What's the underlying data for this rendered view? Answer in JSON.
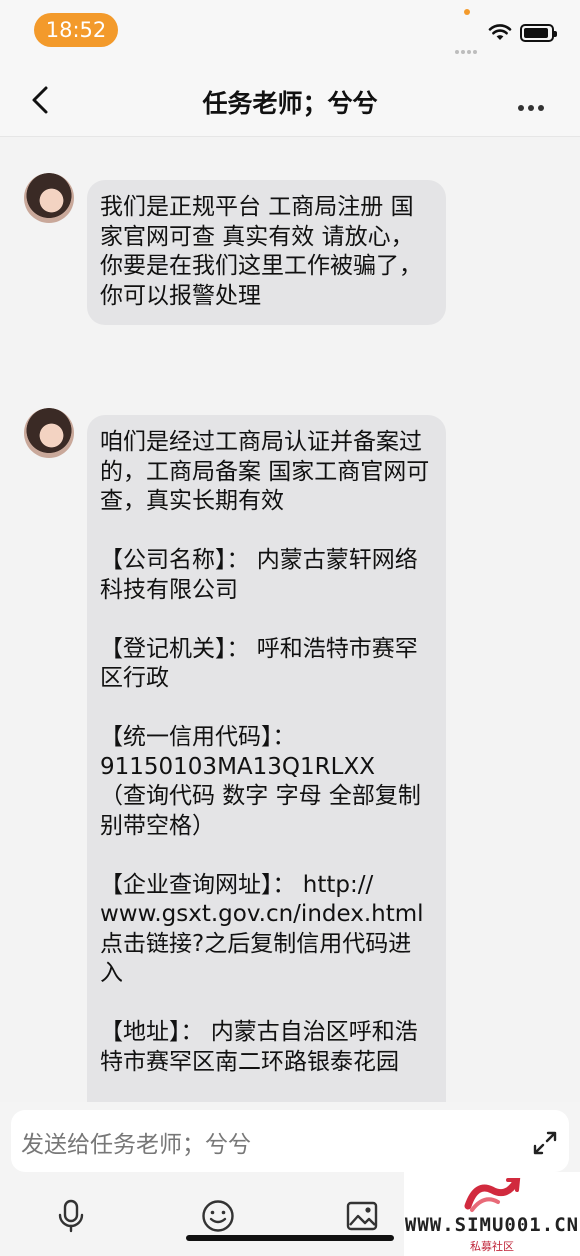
{
  "status_bar": {
    "time": "18:52"
  },
  "header": {
    "title": "任务老师；兮兮"
  },
  "messages": [
    {
      "text": "我们是正规平台 工商局注册 国家官网可查 真实有效 请放心， 你要是在我们这里工作被骗了， 你可以报警处理"
    },
    {
      "text": "咱们是经过工商局认证并备案过的，工商局备案 国家工商官网可查，真实长期有效\n\n【公司名称】： 内蒙古蒙轩网络科技有限公司\n\n【登记机关】： 呼和浩特市赛罕区行政\n\n【统一信用代码】：\n91150103MA13Q1RLXX\n（查询代码 数字 字母 全部复制 别带空格）\n\n【企业查询网址】： http://\nwww.gsxt.gov.cn/index.html\n点击链接?之后复制信用代码进入\n\n【地址】： 内蒙古自治区呼和浩特市赛罕区南二环路银泰花园"
    }
  ],
  "composer": {
    "placeholder": "发送给任务老师；兮兮"
  },
  "toolbar": {
    "icons": [
      "microphone-icon",
      "emoji-icon",
      "image-icon"
    ]
  },
  "watermark": {
    "url": "WWW.SIMU001.CN",
    "sub": "私募社区"
  }
}
